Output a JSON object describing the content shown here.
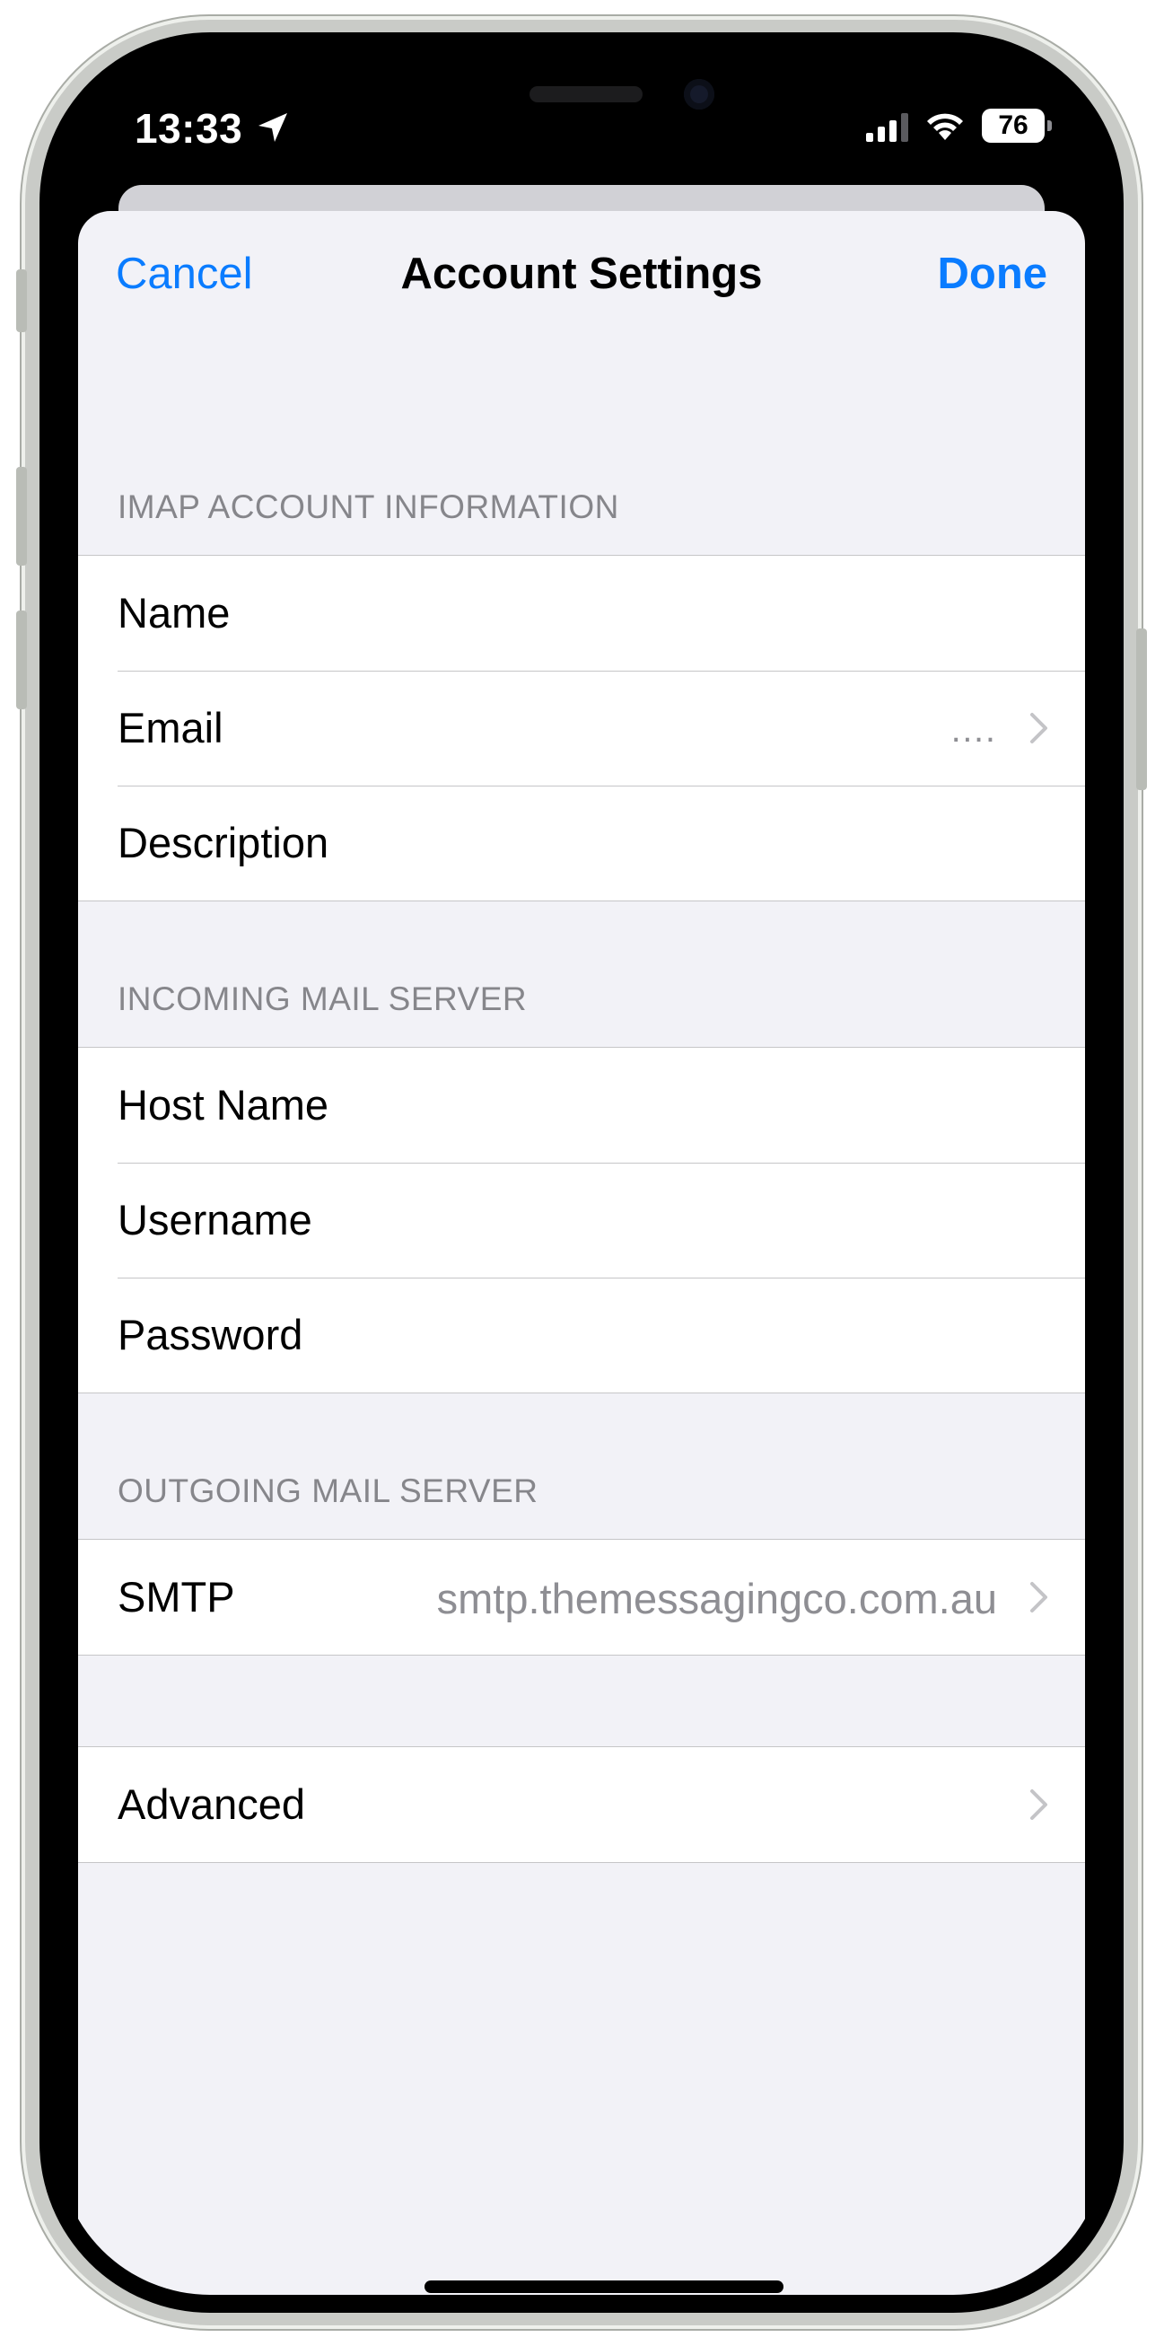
{
  "status_bar": {
    "time": "13:33",
    "battery": "76",
    "icons": [
      "location-arrow-icon",
      "cellular-signal-icon",
      "wifi-icon",
      "battery-icon"
    ]
  },
  "nav": {
    "cancel_label": "Cancel",
    "title": "Account Settings",
    "done_label": "Done"
  },
  "sections": {
    "imap": {
      "header": "IMAP ACCOUNT INFORMATION",
      "rows": [
        {
          "label": "Name",
          "value": ""
        },
        {
          "label": "Email",
          "value": "…."
        },
        {
          "label": "Description",
          "value": ""
        }
      ]
    },
    "incoming": {
      "header": "INCOMING MAIL SERVER",
      "rows": [
        {
          "label": "Host Name",
          "value": ""
        },
        {
          "label": "Username",
          "value": ""
        },
        {
          "label": "Password",
          "value": ""
        }
      ]
    },
    "outgoing": {
      "header": "OUTGOING MAIL SERVER",
      "rows": [
        {
          "label": "SMTP",
          "value": "smtp.themessagingco.com.au"
        }
      ]
    },
    "advanced": {
      "rows": [
        {
          "label": "Advanced",
          "value": ""
        }
      ]
    }
  },
  "colors": {
    "accent": "#0a7cff",
    "background": "#f2f2f7",
    "secondary_text": "#8e8e93"
  }
}
